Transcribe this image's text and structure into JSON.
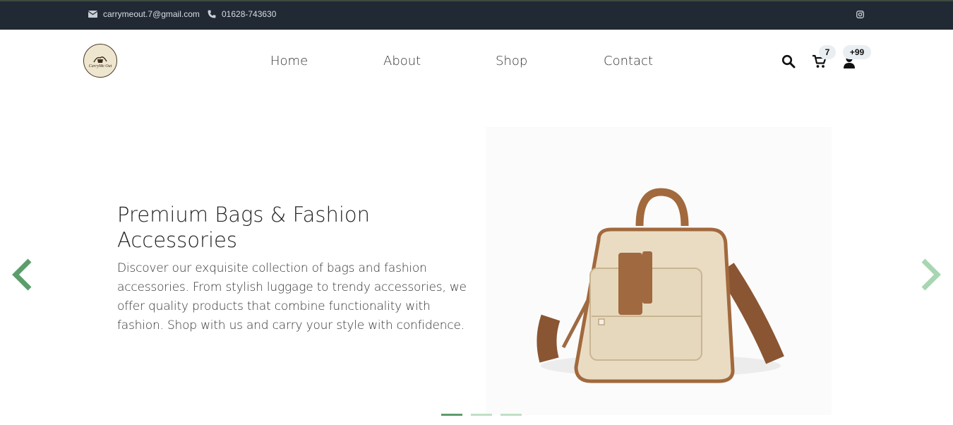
{
  "topbar": {
    "email": "carrymeout.7@gmail.com",
    "phone": "01628-743630",
    "email_icon": "envelope-icon",
    "phone_icon": "phone-icon",
    "social_icon": "instagram-icon"
  },
  "navbar": {
    "logo_text": "CarryMe Out",
    "menu": [
      "Home",
      "About",
      "Shop",
      "Contact"
    ],
    "cart_count": "7",
    "user_count": "+99",
    "icons": [
      "search-icon",
      "cart-icon",
      "user-icon"
    ]
  },
  "hero": {
    "title": "Premium Bags & Fashion Accessories",
    "description": "Discover our exquisite collection of bags and fashion accessories. From stylish luggage to trendy accessories, we offer quality products that combine functionality with fashion. Shop with us and carry your style with confidence.",
    "image": "beige-brown-handbag",
    "slide_count": 3,
    "active_slide": 1
  },
  "colors": {
    "topbar_bg": "#212934",
    "accent_green": "#5c9d6c",
    "arrow_prev": "#5c9d6c",
    "arrow_next": "#a8d6b2"
  }
}
